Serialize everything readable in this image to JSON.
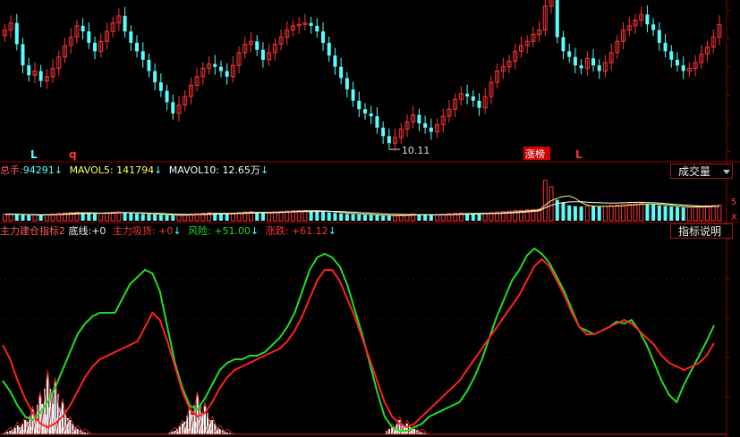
{
  "colors": {
    "up": "#ff3232",
    "down": "#54ffff",
    "panel_line": "#8b0000",
    "green_line": "#22dd22",
    "red_line": "#ff2020",
    "ma_yellow": "#ffff66",
    "ma_white": "#ffffff"
  },
  "price_panel": {
    "markers": [
      "L",
      "q",
      "L"
    ],
    "low_label": "10.11",
    "tag_label": "涨榜"
  },
  "volume_panel": {
    "label": "总手:",
    "value": "94291",
    "mavol5_label": "MAVOL5:",
    "mavol5_value": "141794",
    "mavol10_label": "MAVOL10:",
    "mavol10_value": "12.65万",
    "button": "成交量",
    "axis_tick": "5",
    "axis_unit": "X"
  },
  "indicator_panel": {
    "name": "主力建仓指标2",
    "base_label": "底线:",
    "base_value": "+0",
    "suck_label": "主力吸货:",
    "suck_value": "+0",
    "risk_label": "风险:",
    "risk_value": "+51.00",
    "rise_label": "涨跌:",
    "rise_value": "+61.12",
    "button": "指标说明"
  },
  "chart_data": [
    {
      "type": "candlestick",
      "title": "",
      "x": [
        1,
        2,
        3,
        4,
        5,
        6,
        7,
        8,
        9,
        10,
        11,
        12,
        13,
        14,
        15,
        16,
        17,
        18,
        19,
        20,
        21,
        22,
        23,
        24,
        25,
        26,
        27,
        28,
        29,
        30,
        31,
        32,
        33,
        34,
        35,
        36,
        37,
        38,
        39,
        40,
        41,
        42,
        43,
        44,
        45,
        46,
        47,
        48,
        49,
        50,
        51,
        52,
        53,
        54,
        55,
        56,
        57,
        58,
        59,
        60,
        61,
        62,
        63,
        64,
        65,
        66,
        67,
        68,
        69,
        70,
        71,
        72,
        73,
        74,
        75,
        76,
        77,
        78,
        79,
        80,
        81,
        82,
        83,
        84,
        85,
        86,
        87,
        88,
        89,
        90,
        91,
        92,
        93,
        94,
        95,
        96,
        97,
        98,
        99,
        100,
        101,
        102,
        103,
        104,
        105,
        106,
        107,
        108,
        109,
        110,
        111,
        112,
        113,
        114,
        115,
        116,
        117,
        118,
        119,
        120,
        121,
        122,
        123,
        124,
        125,
        126,
        127,
        128,
        129,
        130,
        131,
        132,
        133,
        134,
        135,
        136,
        137,
        138,
        139,
        140
      ],
      "close": [
        14.3,
        14.55,
        13.8,
        13.05,
        12.7,
        12.85,
        12.5,
        12.65,
        12.95,
        13.35,
        13.75,
        14.05,
        14.45,
        14.25,
        13.85,
        13.55,
        13.9,
        14.25,
        14.55,
        14.8,
        14.25,
        13.85,
        13.55,
        13.25,
        12.85,
        12.45,
        12.15,
        11.75,
        11.35,
        11.65,
        11.95,
        12.35,
        12.65,
        12.95,
        13.1,
        13.0,
        12.85,
        12.65,
        13.05,
        13.5,
        13.8,
        13.9,
        13.6,
        13.25,
        13.5,
        13.8,
        14.05,
        14.3,
        14.45,
        14.5,
        14.55,
        14.45,
        14.25,
        13.85,
        13.4,
        13.0,
        12.6,
        12.2,
        11.8,
        11.5,
        11.35,
        11.25,
        10.85,
        10.55,
        10.3,
        10.5,
        10.8,
        11.05,
        11.3,
        11.0,
        10.85,
        10.7,
        10.95,
        11.25,
        11.5,
        11.85,
        12.05,
        11.95,
        11.8,
        11.55,
        11.95,
        12.45,
        12.85,
        13.0,
        13.2,
        13.55,
        13.75,
        13.9,
        14.15,
        14.3,
        15.15,
        15.8,
        14.05,
        13.55,
        13.35,
        13.05,
        12.95,
        13.3,
        13.05,
        12.85,
        13.15,
        13.5,
        13.9,
        14.3,
        14.45,
        14.65,
        14.85,
        14.5,
        14.3,
        13.85,
        13.55,
        13.25,
        13.05,
        12.85,
        12.95,
        13.15,
        13.45,
        13.7,
        14.05,
        14.5
      ],
      "ylim": [
        9.8,
        15.3
      ],
      "y_unit": "price",
      "low_point_label": "10.11"
    },
    {
      "type": "bar",
      "title": "",
      "series": [
        {
          "name": "总手",
          "values": [
            40,
            42,
            38,
            35,
            33,
            36,
            34,
            38,
            41,
            45,
            48,
            50,
            52,
            49,
            46,
            43,
            45,
            48,
            52,
            55,
            50,
            47,
            44,
            42,
            40,
            38,
            36,
            34,
            32,
            35,
            38,
            41,
            44,
            47,
            49,
            48,
            46,
            44,
            47,
            51,
            54,
            56,
            53,
            50,
            52,
            55,
            58,
            60,
            62,
            63,
            64,
            62,
            60,
            56,
            52,
            48,
            45,
            42,
            40,
            38,
            36,
            35,
            33,
            31,
            30,
            32,
            35,
            38,
            41,
            38,
            36,
            34,
            37,
            40,
            43,
            46,
            48,
            47,
            45,
            43,
            46,
            50,
            54,
            57,
            60,
            63,
            65,
            67,
            70,
            72,
            250,
            210,
            130,
            110,
            95,
            90,
            88,
            92,
            90,
            86,
            89,
            93,
            97,
            100,
            103,
            105,
            108,
            103,
            100,
            95,
            91,
            88,
            85,
            82,
            84,
            86,
            89,
            92,
            95,
            98
          ]
        },
        {
          "name": "MAVOL5",
          "values": [
            40,
            41,
            40,
            38,
            37,
            36,
            35,
            36,
            37,
            39,
            42,
            45,
            48,
            49,
            49,
            48,
            47,
            46,
            47,
            49,
            51,
            50,
            49,
            47,
            44,
            42,
            40,
            38,
            36,
            35,
            35,
            36,
            38,
            41,
            44,
            46,
            46,
            46,
            46,
            47,
            49,
            51,
            52,
            52,
            52,
            52,
            53,
            55,
            57,
            59,
            61,
            62,
            62,
            61,
            59,
            55,
            52,
            48,
            45,
            42,
            40,
            38,
            36,
            34,
            33,
            32,
            32,
            33,
            35,
            36,
            37,
            37,
            37,
            37,
            38,
            40,
            42,
            44,
            45,
            46,
            46,
            46,
            47,
            49,
            52,
            55,
            58,
            61,
            64,
            67,
            97,
            124,
            140,
            150,
            154,
            139,
            113,
            97,
            91,
            89,
            89,
            90,
            91,
            93,
            96,
            99,
            102,
            103,
            103,
            102,
            99,
            95,
            91,
            88,
            86,
            85,
            85,
            86,
            88,
            91
          ]
        },
        {
          "name": "MAVOL10",
          "values": [
            40,
            40,
            40,
            39,
            38,
            38,
            37,
            37,
            37,
            38,
            39,
            40,
            42,
            44,
            45,
            46,
            47,
            48,
            49,
            50,
            50,
            49,
            49,
            48,
            47,
            46,
            45,
            43,
            41,
            40,
            39,
            38,
            38,
            38,
            39,
            40,
            41,
            42,
            43,
            45,
            46,
            47,
            48,
            49,
            49,
            50,
            51,
            53,
            55,
            56,
            57,
            57,
            57,
            58,
            58,
            58,
            57,
            55,
            53,
            51,
            49,
            47,
            45,
            43,
            41,
            40,
            39,
            38,
            38,
            37,
            37,
            36,
            36,
            37,
            37,
            38,
            39,
            40,
            41,
            42,
            43,
            44,
            45,
            46,
            48,
            50,
            52,
            55,
            58,
            61,
            80,
            95,
            106,
            113,
            116,
            117,
            117,
            115,
            113,
            111,
            110,
            109,
            110,
            111,
            113,
            114,
            114,
            113,
            111,
            109,
            106,
            103,
            100,
            97,
            95,
            93,
            91,
            90,
            89,
            89
          ]
        }
      ],
      "ylim": [
        0,
        260
      ],
      "axis_tick_label": "5",
      "axis_unit_label": "X"
    },
    {
      "type": "line",
      "title": "主力建仓指标2",
      "series": [
        {
          "name": "风险",
          "values": [
            30,
            24,
            16,
            10,
            8,
            12,
            18,
            26,
            36,
            46,
            56,
            62,
            66,
            68,
            68,
            68,
            76,
            84,
            88,
            92,
            90,
            80,
            60,
            40,
            26,
            16,
            14,
            20,
            28,
            36,
            40,
            42,
            42,
            44,
            44,
            46,
            50,
            54,
            60,
            68,
            80,
            92,
            99,
            101,
            99,
            94,
            84,
            70,
            56,
            40,
            24,
            10,
            4,
            2,
            2,
            4,
            6,
            10,
            12,
            14,
            16,
            18,
            24,
            32,
            42,
            54,
            66,
            76,
            86,
            92,
            100,
            104,
            101,
            96,
            88,
            80,
            70,
            60,
            58,
            56,
            58,
            60,
            63,
            62,
            64,
            58,
            50,
            40,
            30,
            22,
            18,
            28,
            36,
            44,
            52,
            61
          ]
        },
        {
          "name": "涨跌",
          "values": [
            50,
            42,
            30,
            20,
            12,
            6,
            4,
            6,
            10,
            16,
            24,
            32,
            38,
            42,
            44,
            46,
            48,
            50,
            52,
            60,
            68,
            64,
            52,
            38,
            24,
            14,
            10,
            12,
            18,
            26,
            32,
            36,
            38,
            40,
            42,
            44,
            46,
            48,
            52,
            58,
            66,
            76,
            86,
            92,
            92,
            86,
            76,
            66,
            54,
            42,
            30,
            18,
            10,
            6,
            4,
            6,
            10,
            14,
            18,
            22,
            26,
            30,
            36,
            42,
            48,
            54,
            60,
            66,
            72,
            78,
            86,
            94,
            98,
            94,
            86,
            78,
            68,
            60,
            56,
            56,
            58,
            60,
            62,
            64,
            62,
            58,
            54,
            50,
            44,
            40,
            38,
            36,
            38,
            40,
            44,
            51
          ]
        },
        {
          "name": "主力吸货",
          "values": [
            0,
            2,
            5,
            8,
            14,
            22,
            34,
            30,
            18,
            8,
            3,
            1,
            0,
            0,
            0,
            0,
            0,
            0,
            0,
            0,
            0,
            0,
            0,
            2,
            6,
            14,
            22,
            16,
            8,
            3,
            1,
            0,
            0,
            0,
            0,
            0,
            0,
            0,
            0,
            0,
            0,
            0,
            0,
            0,
            0,
            0,
            0,
            0,
            0,
            0,
            0,
            0,
            4,
            8,
            6,
            3,
            1,
            0,
            0,
            0,
            0,
            0,
            0,
            0,
            0,
            0,
            0,
            0,
            0,
            0,
            0,
            0,
            0,
            0,
            0,
            0,
            0,
            0,
            0,
            0,
            0,
            0,
            0,
            0,
            0,
            0,
            0,
            0,
            0,
            0,
            0,
            0,
            0,
            0,
            0,
            0
          ]
        }
      ],
      "ylim": [
        0,
        110
      ],
      "base_line": 0
    }
  ]
}
